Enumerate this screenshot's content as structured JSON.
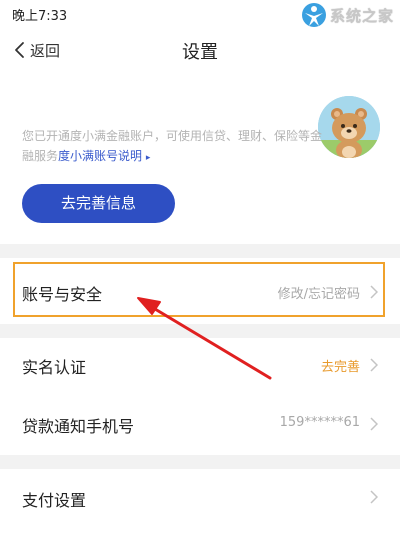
{
  "status_bar": {
    "time": "晚上7:33",
    "dots": "···"
  },
  "watermark": {
    "text": "系统之家"
  },
  "nav": {
    "back_label": "返回",
    "title": "设置"
  },
  "info": {
    "text": "您已开通度小满金融账户，可使用信贷、理财、保险等金融服务",
    "link": "度小满账号说明",
    "link_arrow": "▸"
  },
  "complete_button": {
    "label": "去完善信息"
  },
  "rows": [
    {
      "label": "账号与安全",
      "value": "修改/忘记密码"
    },
    {
      "label": "实名认证",
      "value": "去完善"
    },
    {
      "label": "贷款通知手机号",
      "value": "159******61"
    },
    {
      "label": "支付设置",
      "value": ""
    }
  ],
  "colors": {
    "primary_blue": "#2e4fc3",
    "link_blue": "#3a5bcc",
    "highlight_orange": "#f0a22c",
    "status_orange": "#e89a2c",
    "annotation_red": "#e02020"
  },
  "icons": {
    "back": "chevron-left-icon",
    "row_arrow": "chevron-right-icon",
    "avatar": "bear-avatar"
  }
}
